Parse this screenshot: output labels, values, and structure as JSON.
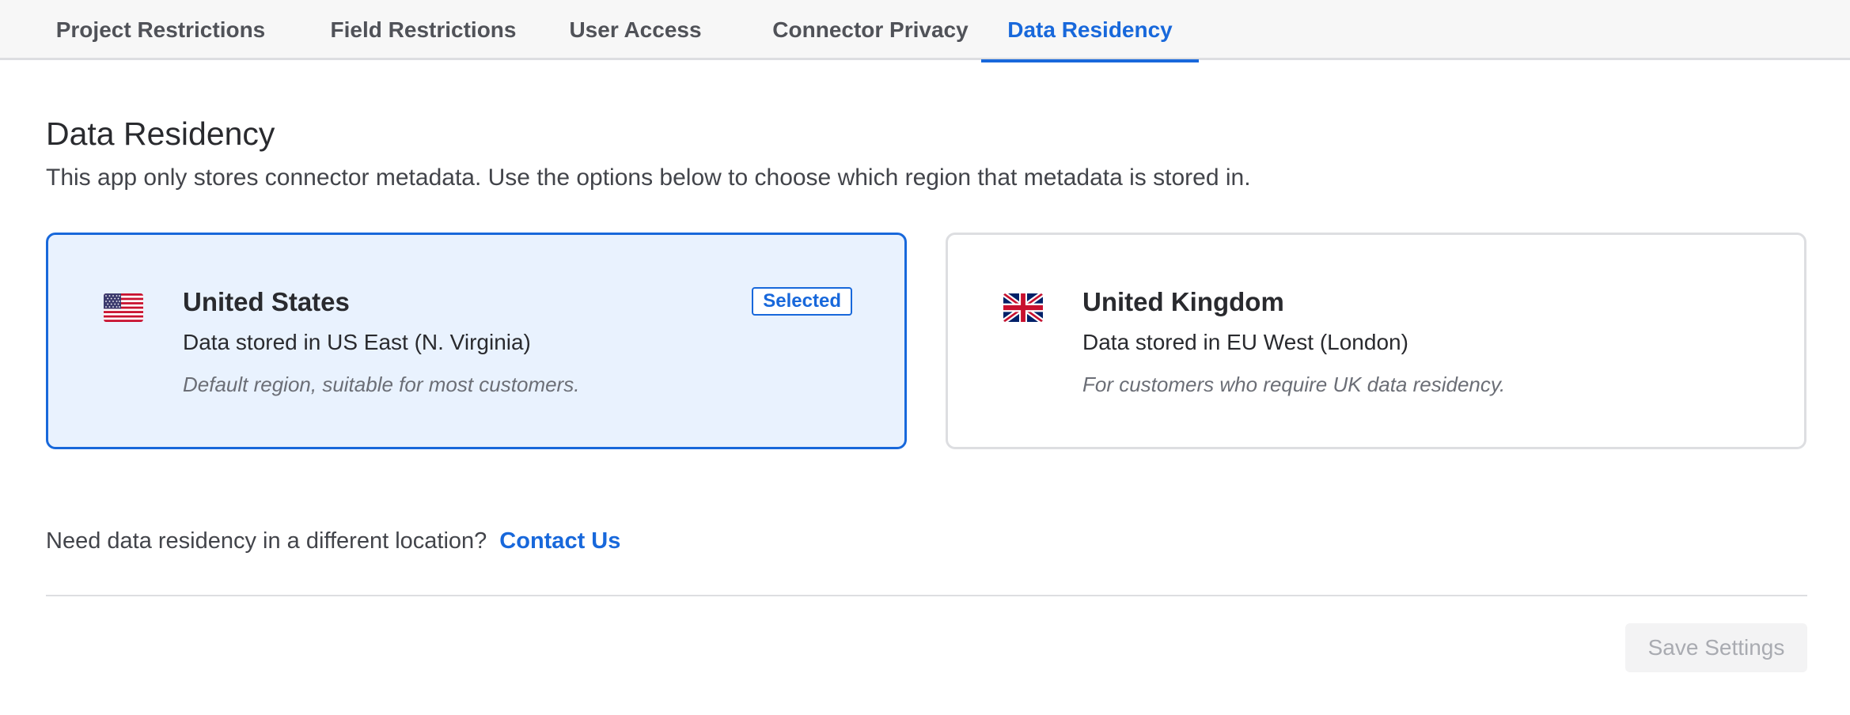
{
  "tabs": [
    {
      "label": "Project Restrictions",
      "active": false
    },
    {
      "label": "Field Restrictions",
      "active": false
    },
    {
      "label": "User Access",
      "active": false
    },
    {
      "label": "Connector Privacy",
      "active": false
    },
    {
      "label": "Data Residency",
      "active": true
    }
  ],
  "page": {
    "title": "Data Residency",
    "description": "This app only stores connector metadata. Use the options below to choose which region that metadata is stored in."
  },
  "regions": [
    {
      "flag_icon": "us-flag-icon",
      "title": "United States",
      "storage": "Data stored in US East (N. Virginia)",
      "note": "Default region, suitable for most customers.",
      "selected": true,
      "badge": "Selected"
    },
    {
      "flag_icon": "uk-flag-icon",
      "title": "United Kingdom",
      "storage": "Data stored in EU West (London)",
      "note": "For customers who require UK data residency.",
      "selected": false
    }
  ],
  "help": {
    "text": "Need data residency in a different location?",
    "link_label": "Contact Us"
  },
  "footer": {
    "save_label": "Save Settings",
    "save_disabled": true
  },
  "colors": {
    "accent": "#1868db",
    "selected_bg": "#e9f2fe",
    "border": "#dddee1",
    "disabled_text": "#a9abb1"
  }
}
